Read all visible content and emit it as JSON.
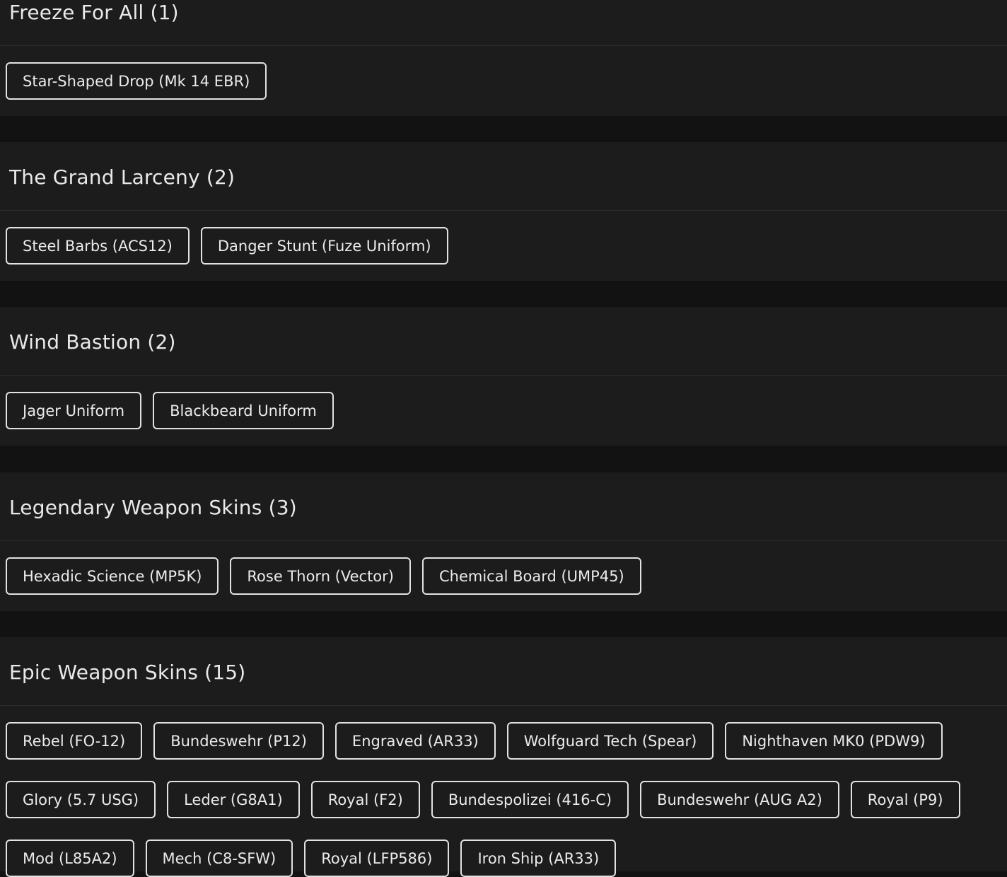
{
  "sections": [
    {
      "title": "Freeze For All (1)",
      "items": [
        "Star-Shaped Drop (Mk 14 EBR)"
      ]
    },
    {
      "title": "The Grand Larceny (2)",
      "items": [
        "Steel Barbs (ACS12)",
        "Danger Stunt (Fuze Uniform)"
      ]
    },
    {
      "title": "Wind Bastion (2)",
      "items": [
        "Jager Uniform",
        "Blackbeard Uniform"
      ]
    },
    {
      "title": "Legendary Weapon Skins (3)",
      "items": [
        "Hexadic Science (MP5K)",
        "Rose Thorn (Vector)",
        "Chemical Board (UMP45)"
      ]
    },
    {
      "title": "Epic Weapon Skins (15)",
      "items": [
        "Rebel (FO-12)",
        "Bundeswehr (P12)",
        "Engraved (AR33)",
        "Wolfguard Tech (Spear)",
        "Nighthaven MK0 (PDW9)",
        "Glory (5.7 USG)",
        "Leder (G8A1)",
        "Royal (F2)",
        "Bundespolizei (416-C)",
        "Bundeswehr (AUG A2)",
        "Royal (P9)",
        "Mod (L85A2)",
        "Mech (C8-SFW)",
        "Royal (LFP586)",
        "Iron Ship (AR33)"
      ]
    }
  ]
}
